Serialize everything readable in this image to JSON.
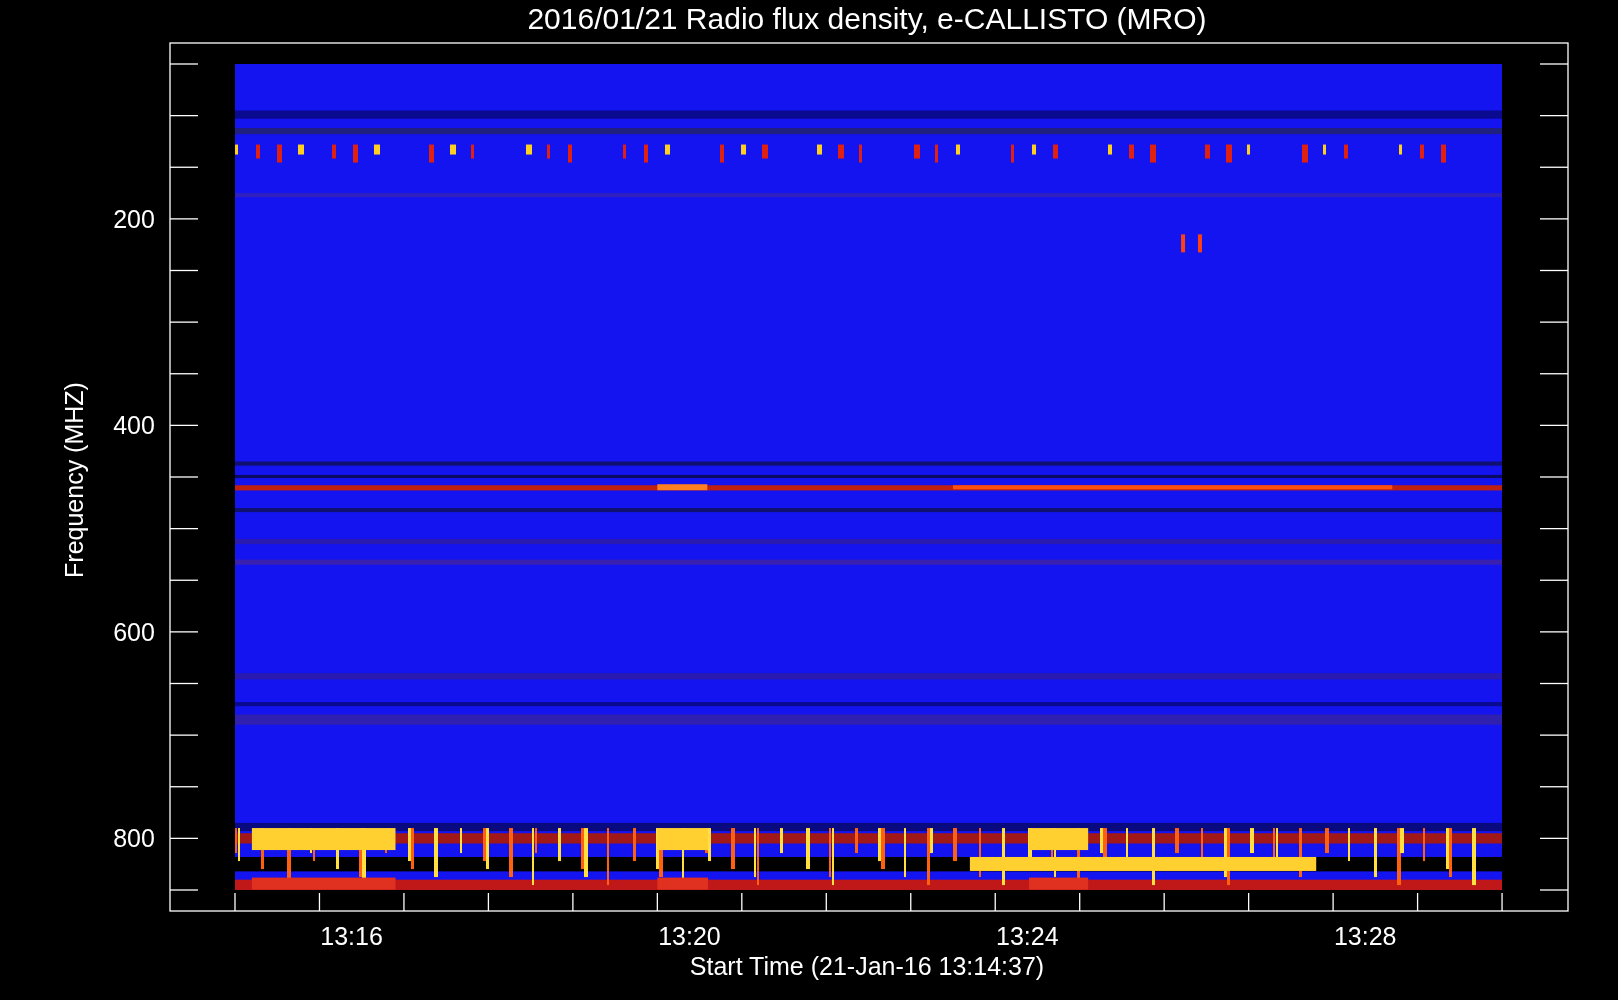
{
  "title": "2016/01/21  Radio flux density, e-CALLISTO (MRO)",
  "y_axis": {
    "label": "Frequency (MHZ)",
    "ticks": [
      "200",
      "400",
      "600",
      "800"
    ]
  },
  "x_axis": {
    "label": "Start Time (21-Jan-16 13:14:37)",
    "ticks": [
      "13:16",
      "13:20",
      "13:24",
      "13:28"
    ]
  }
}
